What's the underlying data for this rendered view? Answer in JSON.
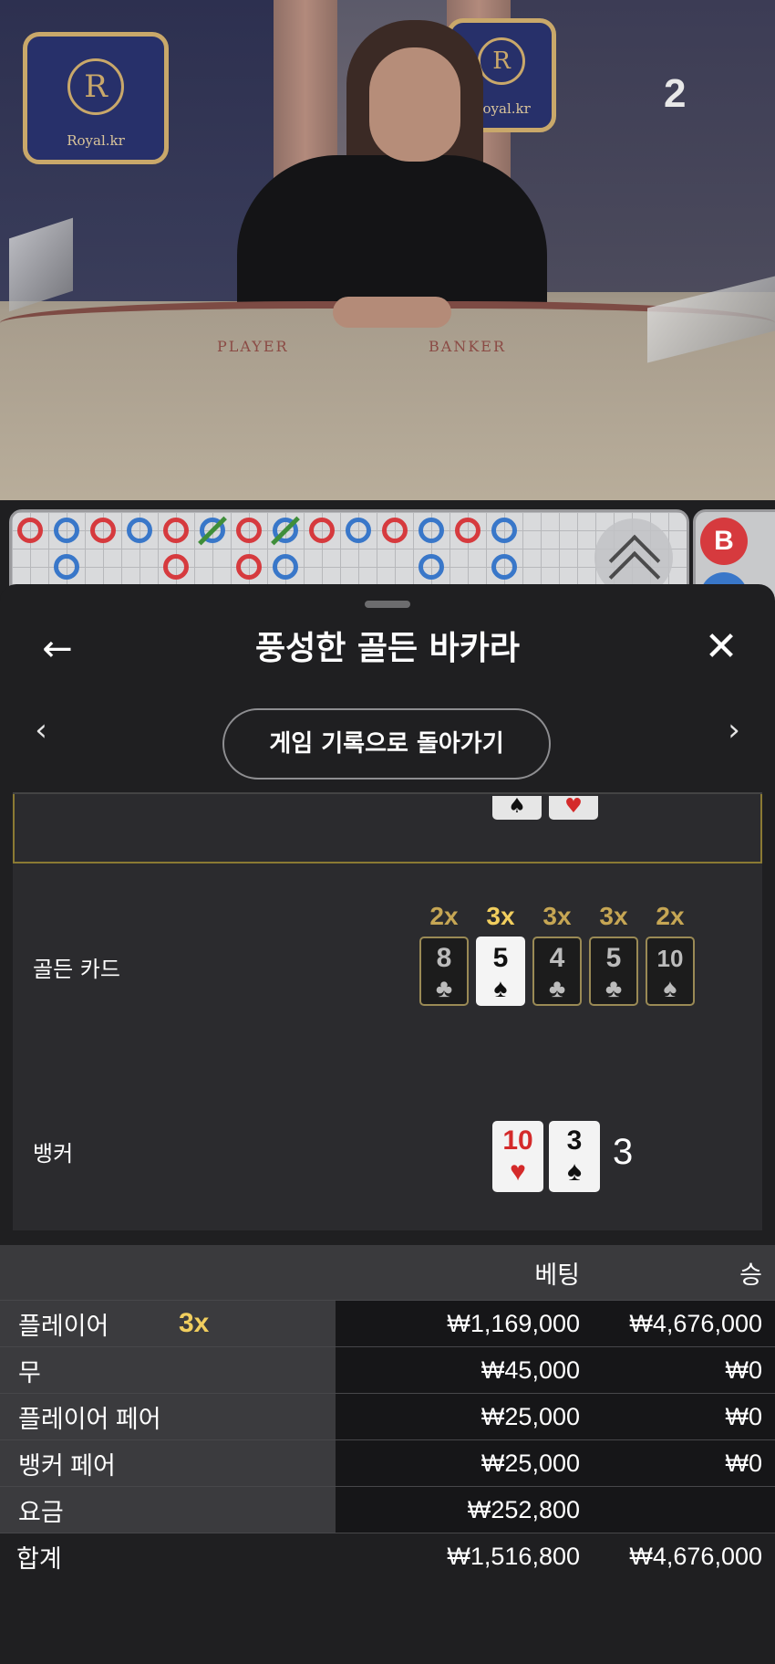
{
  "video": {
    "logo_left_letter": "R",
    "logo_left_name": "Royal.kr",
    "logo_right_letter": "R",
    "logo_right_name": "Royal.kr",
    "table_player": "PLAYER",
    "table_banker": "BANKER",
    "round_number": "2"
  },
  "roadmap": {
    "bead_top": "B"
  },
  "sheet": {
    "back_icon": "arrow-left-icon",
    "title": "풍성한 골든 바카라",
    "close_icon": "close-icon",
    "prev_icon": "chevron-left-icon",
    "next_icon": "chevron-right-icon",
    "back_to_history": "게임 기록으로 돌아가기"
  },
  "golden_cards": {
    "label": "골든 카드",
    "cards": [
      {
        "multiplier": "2x",
        "rank": "8",
        "suit": "♣",
        "active": false
      },
      {
        "multiplier": "3x",
        "rank": "5",
        "suit": "♠",
        "active": true
      },
      {
        "multiplier": "3x",
        "rank": "4",
        "suit": "♣",
        "active": false
      },
      {
        "multiplier": "3x",
        "rank": "5",
        "suit": "♣",
        "active": false
      },
      {
        "multiplier": "2x",
        "rank": "10",
        "suit": "♠",
        "active": false
      }
    ]
  },
  "banker": {
    "label": "뱅커",
    "cards": [
      {
        "rank": "10",
        "suit": "♥",
        "color": "#d42a2a"
      },
      {
        "rank": "3",
        "suit": "♠",
        "color": "#111111"
      }
    ],
    "score": "3"
  },
  "bets": {
    "headers": {
      "bet": "베팅",
      "win": "승"
    },
    "rows": [
      {
        "label": "플레이어",
        "badge": "3x",
        "bet": "₩1,169,000",
        "win": "₩4,676,000"
      },
      {
        "label": "무",
        "badge": "",
        "bet": "₩45,000",
        "win": "₩0"
      },
      {
        "label": "플레이어 페어",
        "badge": "",
        "bet": "₩25,000",
        "win": "₩0"
      },
      {
        "label": "뱅커 페어",
        "badge": "",
        "bet": "₩25,000",
        "win": "₩0"
      },
      {
        "label": "요금",
        "badge": "",
        "bet": "₩252,800",
        "win": ""
      }
    ],
    "total": {
      "label": "합계",
      "bet": "₩1,516,800",
      "win": "₩4,676,000"
    }
  }
}
